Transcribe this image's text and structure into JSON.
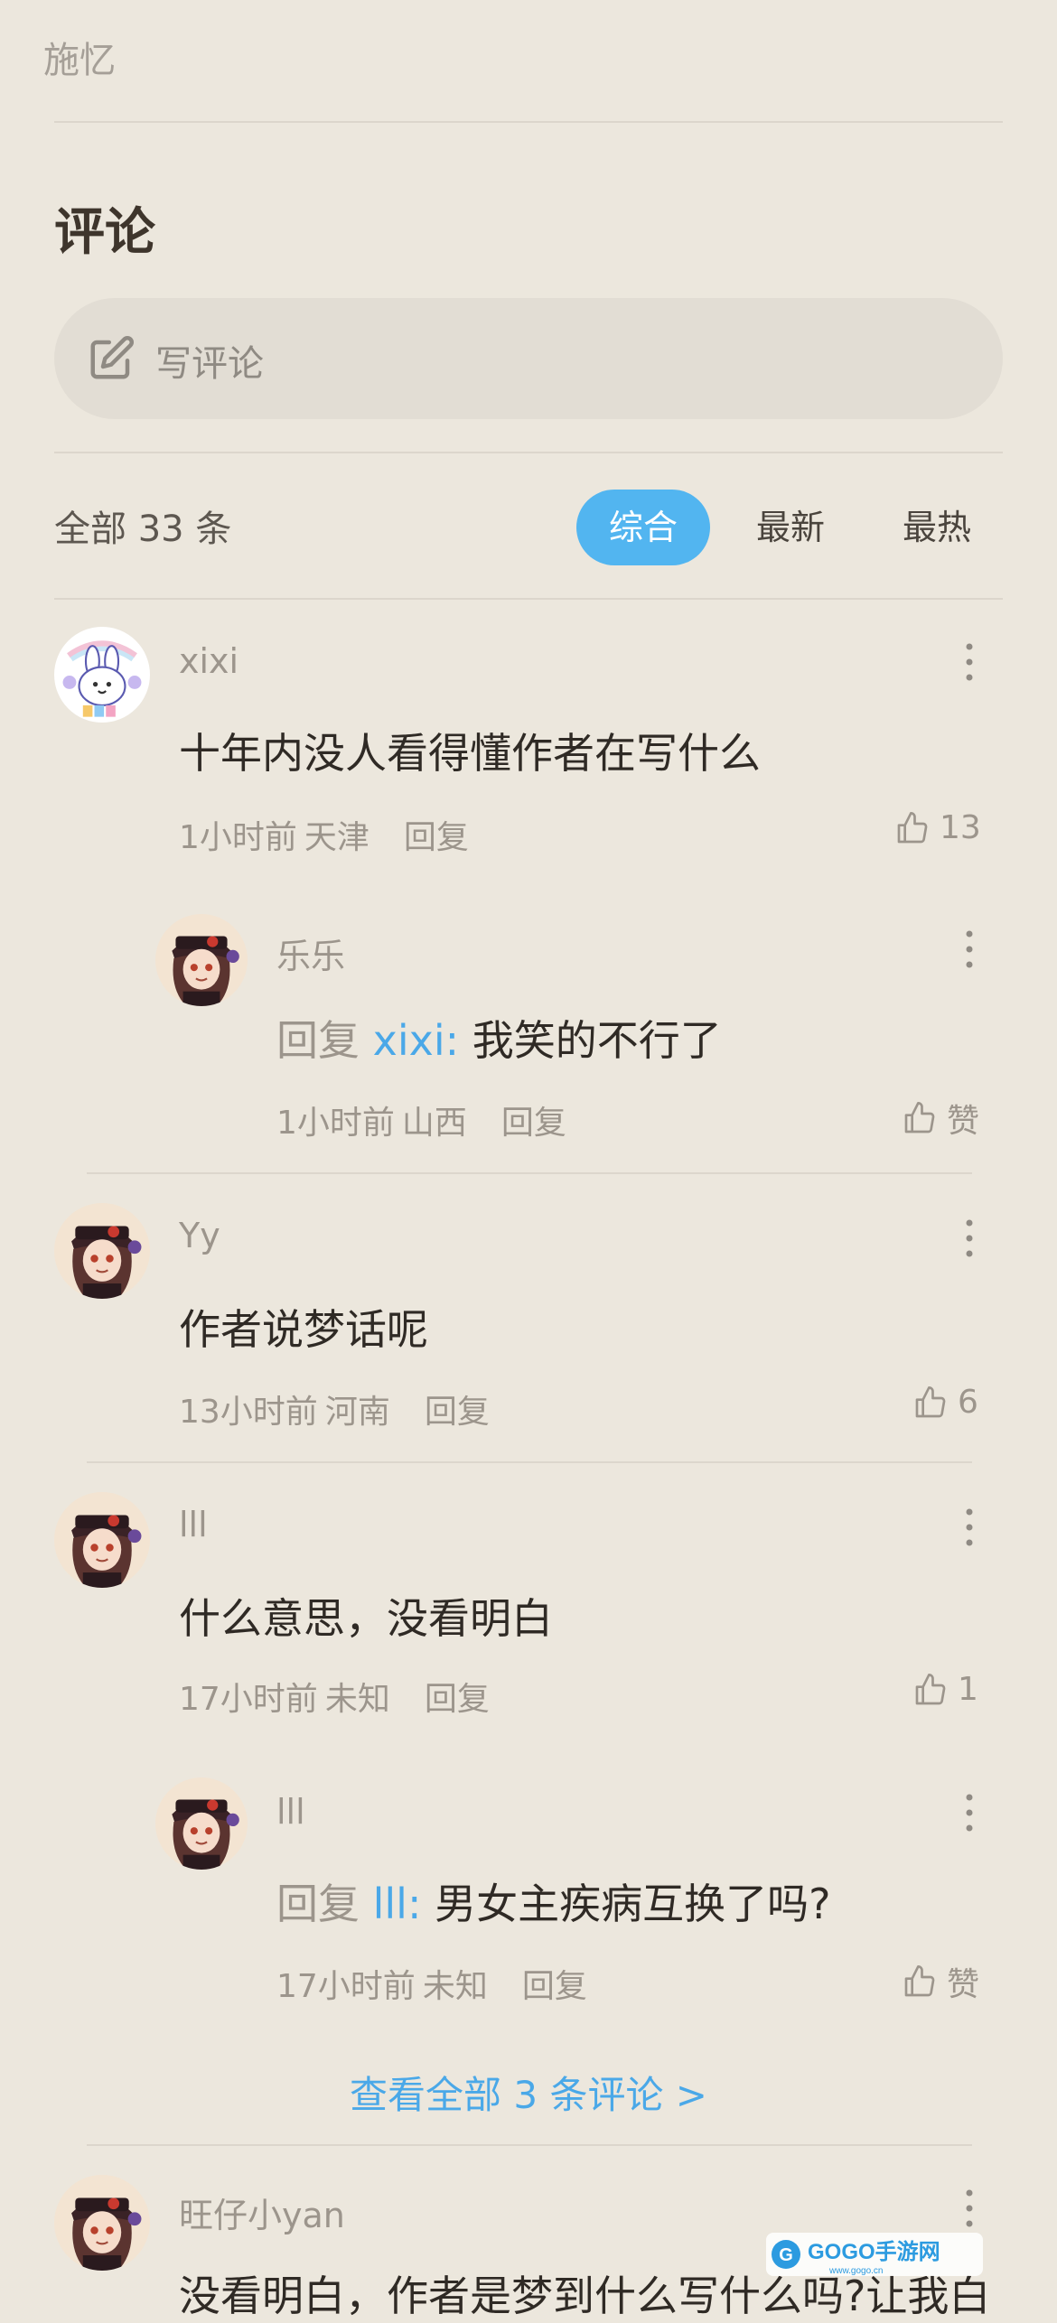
{
  "header": {
    "author": "施忆"
  },
  "comments_section": {
    "title": "评论",
    "write_placeholder": "写评论",
    "count_label": "全部 33 条",
    "tabs": [
      "综合",
      "最新",
      "最热"
    ],
    "active_tab": "综合"
  },
  "comments": [
    {
      "user": "xixi",
      "text": "十年内没人看得懂作者在写什么",
      "time": "1小时前",
      "location": "天津",
      "reply_label": "回复",
      "likes": "13",
      "replies": [
        {
          "user": "乐乐",
          "reply_prefix": "回复",
          "mention": "xixi",
          "colon": ":",
          "text": " 我笑的不行了",
          "time": "1小时前",
          "location": "山西",
          "reply_label": "回复",
          "likes": "赞"
        }
      ]
    },
    {
      "user": "Yy",
      "text": "作者说梦话呢",
      "time": "13小时前",
      "location": "河南",
      "reply_label": "回复",
      "likes": "6"
    },
    {
      "user": "lll",
      "text": "什么意思，没看明白",
      "time": "17小时前",
      "location": "未知",
      "reply_label": "回复",
      "likes": "1",
      "replies": [
        {
          "user": "lll",
          "reply_prefix": "回复",
          "mention": "lll",
          "colon": ":",
          "text": " 男女主疾病互换了吗?",
          "time": "17小时前",
          "location": "未知",
          "reply_label": "回复",
          "likes": "赞"
        }
      ],
      "view_all": "查看全部 3 条评论 >"
    },
    {
      "user": "旺仔小yan",
      "text": "没看明白，作者是梦到什么写什么吗?让我白"
    }
  ],
  "watermark": {
    "text": "GOGO手游网",
    "sub": "www.gogo.cn"
  },
  "colors": {
    "accent": "#52b5f0",
    "link": "#4aa8e8",
    "background": "#ece7dd"
  },
  "icons": [
    "pen-icon",
    "thumbs-up-icon",
    "more-vertical-icon",
    "avatar-bunny",
    "avatar-anime-girl"
  ]
}
